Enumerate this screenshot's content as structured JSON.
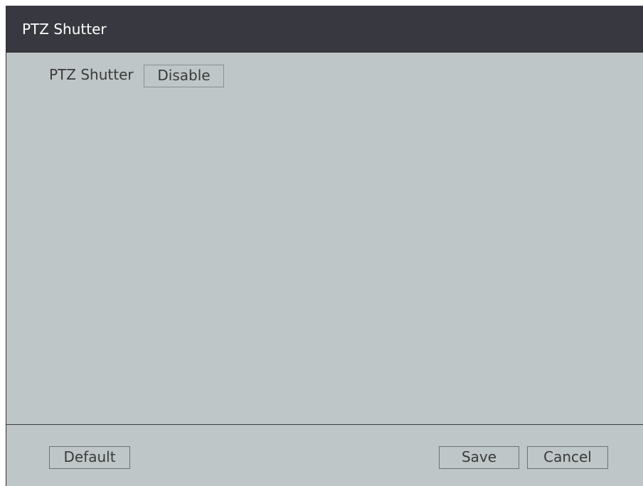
{
  "dialog": {
    "title": "PTZ Shutter"
  },
  "settings": {
    "ptz_shutter_label": "PTZ Shutter",
    "ptz_shutter_value": "Disable"
  },
  "footer": {
    "default_label": "Default",
    "save_label": "Save",
    "cancel_label": "Cancel"
  },
  "colors": {
    "titlebar_bg": "#383840",
    "panel_bg": "#bfc6c7",
    "text": "#3a3a3a",
    "title_text": "#ffffff"
  }
}
